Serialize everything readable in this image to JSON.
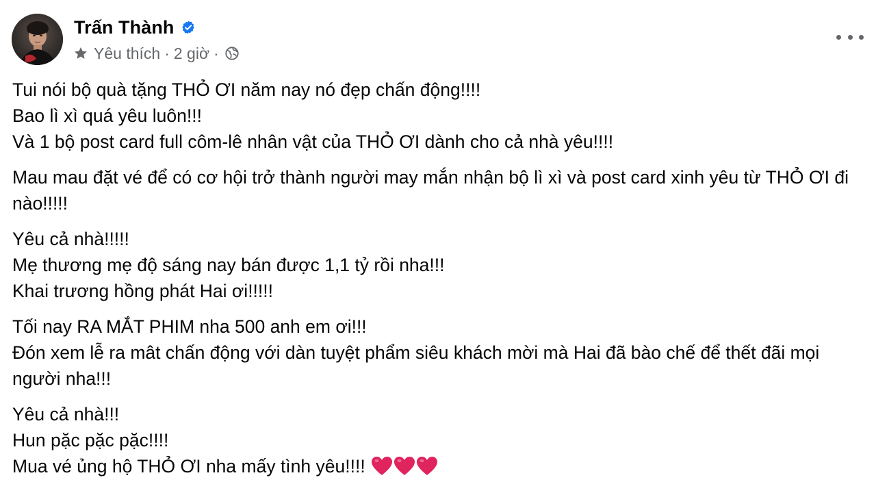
{
  "post": {
    "author": {
      "name": "Trấn Thành",
      "verified_icon": "verified-badge-icon",
      "avatar_icon": "avatar-photo"
    },
    "meta": {
      "favorite_icon": "star-icon",
      "favorite_label": "Yêu thích",
      "separator": "·",
      "time": "2 giờ",
      "audience_icon": "globe-icon"
    },
    "more_icon": "more-options-icon",
    "paragraphs": [
      {
        "lines": [
          "Tui nói bộ quà tặng THỎ ƠI năm nay nó đẹp chấn động!!!!",
          "Bao lì xì quá yêu luôn!!!",
          "Và 1 bộ post card full côm-lê nhân vật của THỎ ƠI dành cho cả nhà yêu!!!!"
        ]
      },
      {
        "lines": [
          "Mau mau đặt vé để có cơ hội trở thành người may mắn nhận bộ lì xì và post card xinh yêu từ THỎ ƠI đi nào!!!!!"
        ]
      },
      {
        "lines": [
          "Yêu cả nhà!!!!!",
          "Mẹ thương mẹ độ sáng nay bán được 1,1 tỷ rồi nha!!!",
          "Khai trương hồng phát Hai ơi!!!!!"
        ]
      },
      {
        "lines": [
          "Tối nay RA MẮT PHIM nha 500 anh em ơi!!!",
          "Đón xem lễ ra mât chấn động với dàn tuyệt phẩm siêu khách mời mà Hai đã bào chế để thết đãi mọi người nha!!!"
        ]
      },
      {
        "lines": [
          "Yêu cả nhà!!!",
          "Hun pặc pặc pặc!!!!",
          "Mua vé ủng hộ THỎ ƠI nha mấy tình yêu!!!!"
        ]
      }
    ],
    "hearts": {
      "icon": "red-heart-icon",
      "count": 3,
      "color": "#e0245e"
    }
  },
  "colors": {
    "text_primary": "#050505",
    "text_secondary": "#65676b",
    "verified_blue": "#1877f2",
    "background": "#ffffff"
  }
}
